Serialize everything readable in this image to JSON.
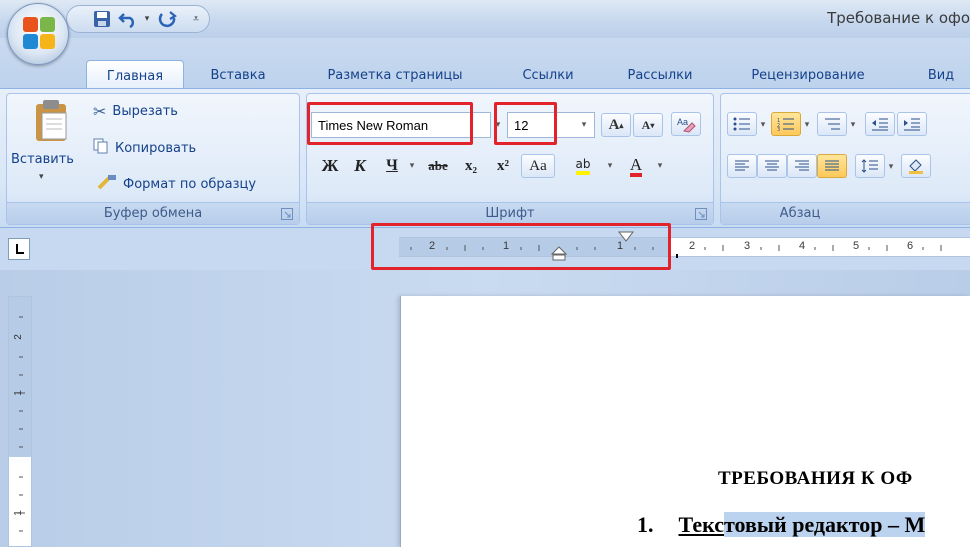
{
  "title_bar": {
    "document_title": "Требование к офо"
  },
  "quick_access": {
    "icons": [
      "save-icon",
      "undo-icon",
      "redo-icon",
      "customize-qat-icon"
    ]
  },
  "tabs": [
    {
      "label": "Главная",
      "active": true
    },
    {
      "label": "Вставка"
    },
    {
      "label": "Разметка страницы"
    },
    {
      "label": "Ссылки"
    },
    {
      "label": "Рассылки"
    },
    {
      "label": "Рецензирование"
    },
    {
      "label": "Вид"
    }
  ],
  "clipboard": {
    "paste_label": "Вставить",
    "cut_label": "Вырезать",
    "copy_label": "Копировать",
    "format_painter_label": "Формат по образцу",
    "group_label": "Буфер обмена"
  },
  "font": {
    "font_name": "Times New Roman",
    "font_size": "12",
    "bold_label": "Ж",
    "italic_label": "К",
    "underline_label": "Ч",
    "strikethrough_label": "abe",
    "subscript_label": "x₂",
    "superscript_label": "x²",
    "change_case_label": "Aa",
    "highlight_label": "ab",
    "font_color_label": "A",
    "group_label": "Шрифт"
  },
  "paragraph": {
    "group_label": "Абзац"
  },
  "ruler": {
    "numbers": [
      "2",
      "1",
      "1",
      "2",
      "3",
      "4",
      "5",
      "6"
    ]
  },
  "document": {
    "heading": "ТРЕБОВАНИЯ  К ОФ",
    "list_number": "1.",
    "line_start": "Текс",
    "line_selected": "товый редактор – M"
  },
  "colors": {
    "highlight_red": "#e3232c",
    "ribbon_text": "#15428b",
    "selection": "#bcd3f0"
  }
}
